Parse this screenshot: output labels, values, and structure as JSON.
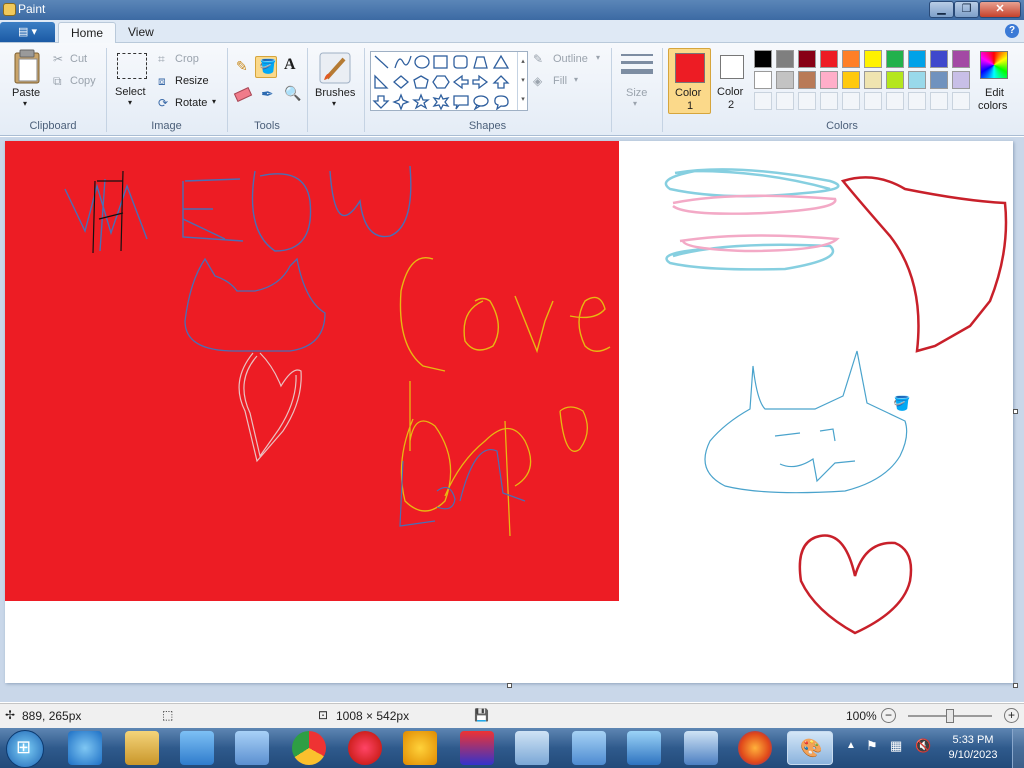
{
  "window": {
    "title": "Paint"
  },
  "tabs": [
    {
      "label": "Home"
    },
    {
      "label": "View"
    }
  ],
  "help_label": "?",
  "clipboard": {
    "paste": "Paste",
    "cut": "Cut",
    "copy": "Copy",
    "group": "Clipboard"
  },
  "image": {
    "select": "Select",
    "crop": "Crop",
    "resize": "Resize",
    "rotate": "Rotate",
    "group": "Image"
  },
  "tools": {
    "group": "Tools"
  },
  "brushes": {
    "label": "Brushes"
  },
  "shapes": {
    "outline": "Outline",
    "fill": "Fill",
    "group": "Shapes"
  },
  "size": {
    "label": "Size"
  },
  "colors": {
    "color1_line1": "Color",
    "color1_line2": "1",
    "color2_line1": "Color",
    "color2_line2": "2",
    "edit_line1": "Edit",
    "edit_line2": "colors",
    "group": "Colors",
    "color1_value": "#ed1c24",
    "color2_value": "#ffffff",
    "palette_row1": [
      "#000000",
      "#7f7f7f",
      "#880015",
      "#ed1c24",
      "#ff7f27",
      "#fff200",
      "#22b14c",
      "#00a2e8",
      "#3f48cc",
      "#a349a4"
    ],
    "palette_row2": [
      "#ffffff",
      "#c3c3c3",
      "#b97a57",
      "#ffaec9",
      "#ffc90e",
      "#efe4b0",
      "#b5e61d",
      "#99d9ea",
      "#7092be",
      "#c8bfe7"
    ],
    "palette_row3_custom_count": 10
  },
  "canvas": {
    "red_fill": "#ed1c24"
  },
  "status": {
    "cursor_pos": "889, 265px",
    "image_size": "1008 × 542px",
    "zoom": "100%"
  },
  "taskbar": {
    "time": "5:33 PM",
    "date": "9/10/2023"
  }
}
